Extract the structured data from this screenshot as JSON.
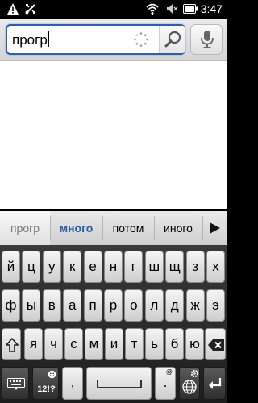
{
  "status_bar": {
    "time": "3:47",
    "icons": [
      "warning-icon",
      "usb-icon",
      "wifi-icon",
      "mute-icon",
      "battery-icon"
    ]
  },
  "search": {
    "query": "прогр",
    "search_icon": "magnifier-icon",
    "voice_icon": "microphone-icon",
    "accent_color": "#2f5fa8"
  },
  "suggestions": {
    "items": [
      "прогр",
      "много",
      "потом",
      "иного"
    ],
    "highlighted_index": 1,
    "more_icon": "play-arrow-icon"
  },
  "keyboard": {
    "row1": [
      "й",
      "ц",
      "у",
      "к",
      "е",
      "н",
      "г",
      "ш",
      "щ",
      "з",
      "х"
    ],
    "row2": [
      "ф",
      "ы",
      "в",
      "а",
      "п",
      "р",
      "о",
      "л",
      "д",
      "ж",
      "э"
    ],
    "row3": [
      "я",
      "ч",
      "с",
      "м",
      "и",
      "т",
      "ь",
      "б",
      "ю"
    ],
    "symbols_label": "12!?",
    "comma": ",",
    "period": ".",
    "period_sub": "@"
  }
}
